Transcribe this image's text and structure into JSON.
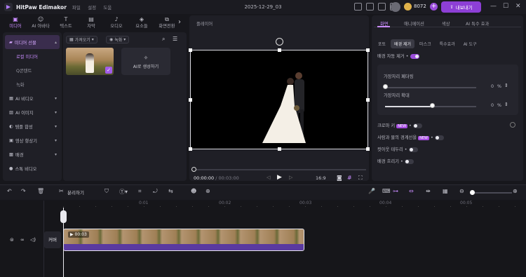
{
  "titlebar": {
    "app_name": "HitPaw Edimakor",
    "menu": [
      "파일",
      "설정",
      "도움"
    ],
    "project": "2025-12-29_03",
    "credits": "8072",
    "export_label": "내보내기",
    "brand_color": "#8d3fd6"
  },
  "toptabs": [
    {
      "label": "미디어",
      "icon": "media-icon",
      "active": true
    },
    {
      "label": "AI 아바타",
      "icon": "avatar-icon"
    },
    {
      "label": "텍스트",
      "icon": "text-icon"
    },
    {
      "label": "자막",
      "icon": "subtitle-icon"
    },
    {
      "label": "오디오",
      "icon": "audio-icon"
    },
    {
      "label": "요소들",
      "icon": "elements-icon"
    },
    {
      "label": "화면전환",
      "icon": "transition-icon"
    }
  ],
  "leftnav": {
    "items": [
      {
        "label": "미디어 선물",
        "active": true
      },
      {
        "label": "로컬 미디어",
        "sub": true,
        "selected": true
      },
      {
        "label": "Q콘텐트",
        "sub": true
      },
      {
        "label": "녹화",
        "sub": true
      },
      {
        "label": "AI 비디오"
      },
      {
        "label": "AI 이미지"
      },
      {
        "label": "템플 합성"
      },
      {
        "label": "영상 향상기"
      },
      {
        "label": "배경"
      },
      {
        "label": "스톡 비디오"
      }
    ]
  },
  "media": {
    "sort_label": "가져오기",
    "filter_label": "녹화",
    "ai_generate_label": "AI로 생성하기",
    "thumb_duration": "00:03"
  },
  "player": {
    "label": "플레이어",
    "current_time": "00:00:00",
    "total_time": "00:03:00",
    "aspect": "16:9"
  },
  "right": {
    "tabs": [
      "화면",
      "애니메이션",
      "색상",
      "AI 특수 효과"
    ],
    "subtabs": [
      "포토",
      "배경 제거",
      "마스크",
      "특수효과",
      "AI 도구"
    ],
    "bg_remove_label": "배경 자동 제거",
    "box": {
      "feather_label": "가장자리 페더링",
      "feather_value": "0",
      "expand_label": "가장자리 확대",
      "expand_value": "0",
      "unit": "%"
    },
    "rows": [
      {
        "label": "크로마 키",
        "new": true,
        "on": false
      },
      {
        "label": "사람과 물의 경계선을",
        "new": true,
        "on": false
      },
      {
        "label": "컷아웃 테두리",
        "on": false
      },
      {
        "label": "배경 흐리기",
        "on": false
      }
    ],
    "badge_new": "NEW"
  },
  "toolbar": {
    "split_label": "분리하기"
  },
  "timeline": {
    "ruler": [
      "0:01",
      "00:02",
      "00:03",
      "00:04",
      "00:05"
    ],
    "track_label": "커버",
    "clip_label": "00:03"
  }
}
